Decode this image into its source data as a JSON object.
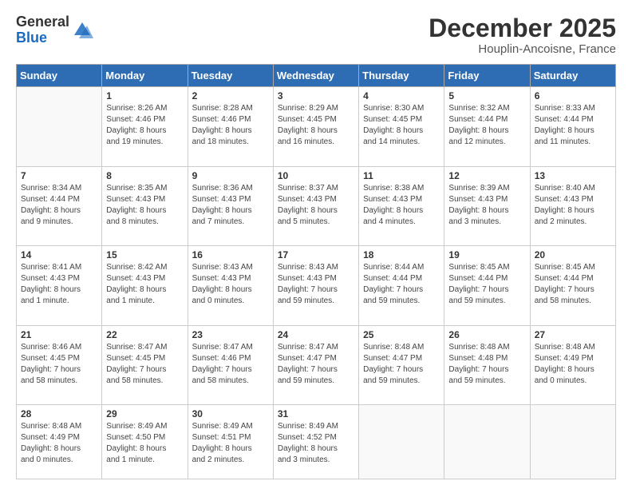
{
  "logo": {
    "general": "General",
    "blue": "Blue"
  },
  "header": {
    "month": "December 2025",
    "location": "Houplin-Ancoisne, France"
  },
  "weekdays": [
    "Sunday",
    "Monday",
    "Tuesday",
    "Wednesday",
    "Thursday",
    "Friday",
    "Saturday"
  ],
  "weeks": [
    [
      {
        "day": "",
        "info": ""
      },
      {
        "day": "1",
        "info": "Sunrise: 8:26 AM\nSunset: 4:46 PM\nDaylight: 8 hours\nand 19 minutes."
      },
      {
        "day": "2",
        "info": "Sunrise: 8:28 AM\nSunset: 4:46 PM\nDaylight: 8 hours\nand 18 minutes."
      },
      {
        "day": "3",
        "info": "Sunrise: 8:29 AM\nSunset: 4:45 PM\nDaylight: 8 hours\nand 16 minutes."
      },
      {
        "day": "4",
        "info": "Sunrise: 8:30 AM\nSunset: 4:45 PM\nDaylight: 8 hours\nand 14 minutes."
      },
      {
        "day": "5",
        "info": "Sunrise: 8:32 AM\nSunset: 4:44 PM\nDaylight: 8 hours\nand 12 minutes."
      },
      {
        "day": "6",
        "info": "Sunrise: 8:33 AM\nSunset: 4:44 PM\nDaylight: 8 hours\nand 11 minutes."
      }
    ],
    [
      {
        "day": "7",
        "info": "Sunrise: 8:34 AM\nSunset: 4:44 PM\nDaylight: 8 hours\nand 9 minutes."
      },
      {
        "day": "8",
        "info": "Sunrise: 8:35 AM\nSunset: 4:43 PM\nDaylight: 8 hours\nand 8 minutes."
      },
      {
        "day": "9",
        "info": "Sunrise: 8:36 AM\nSunset: 4:43 PM\nDaylight: 8 hours\nand 7 minutes."
      },
      {
        "day": "10",
        "info": "Sunrise: 8:37 AM\nSunset: 4:43 PM\nDaylight: 8 hours\nand 5 minutes."
      },
      {
        "day": "11",
        "info": "Sunrise: 8:38 AM\nSunset: 4:43 PM\nDaylight: 8 hours\nand 4 minutes."
      },
      {
        "day": "12",
        "info": "Sunrise: 8:39 AM\nSunset: 4:43 PM\nDaylight: 8 hours\nand 3 minutes."
      },
      {
        "day": "13",
        "info": "Sunrise: 8:40 AM\nSunset: 4:43 PM\nDaylight: 8 hours\nand 2 minutes."
      }
    ],
    [
      {
        "day": "14",
        "info": "Sunrise: 8:41 AM\nSunset: 4:43 PM\nDaylight: 8 hours\nand 1 minute."
      },
      {
        "day": "15",
        "info": "Sunrise: 8:42 AM\nSunset: 4:43 PM\nDaylight: 8 hours\nand 1 minute."
      },
      {
        "day": "16",
        "info": "Sunrise: 8:43 AM\nSunset: 4:43 PM\nDaylight: 8 hours\nand 0 minutes."
      },
      {
        "day": "17",
        "info": "Sunrise: 8:43 AM\nSunset: 4:43 PM\nDaylight: 7 hours\nand 59 minutes."
      },
      {
        "day": "18",
        "info": "Sunrise: 8:44 AM\nSunset: 4:44 PM\nDaylight: 7 hours\nand 59 minutes."
      },
      {
        "day": "19",
        "info": "Sunrise: 8:45 AM\nSunset: 4:44 PM\nDaylight: 7 hours\nand 59 minutes."
      },
      {
        "day": "20",
        "info": "Sunrise: 8:45 AM\nSunset: 4:44 PM\nDaylight: 7 hours\nand 58 minutes."
      }
    ],
    [
      {
        "day": "21",
        "info": "Sunrise: 8:46 AM\nSunset: 4:45 PM\nDaylight: 7 hours\nand 58 minutes."
      },
      {
        "day": "22",
        "info": "Sunrise: 8:47 AM\nSunset: 4:45 PM\nDaylight: 7 hours\nand 58 minutes."
      },
      {
        "day": "23",
        "info": "Sunrise: 8:47 AM\nSunset: 4:46 PM\nDaylight: 7 hours\nand 58 minutes."
      },
      {
        "day": "24",
        "info": "Sunrise: 8:47 AM\nSunset: 4:47 PM\nDaylight: 7 hours\nand 59 minutes."
      },
      {
        "day": "25",
        "info": "Sunrise: 8:48 AM\nSunset: 4:47 PM\nDaylight: 7 hours\nand 59 minutes."
      },
      {
        "day": "26",
        "info": "Sunrise: 8:48 AM\nSunset: 4:48 PM\nDaylight: 7 hours\nand 59 minutes."
      },
      {
        "day": "27",
        "info": "Sunrise: 8:48 AM\nSunset: 4:49 PM\nDaylight: 8 hours\nand 0 minutes."
      }
    ],
    [
      {
        "day": "28",
        "info": "Sunrise: 8:48 AM\nSunset: 4:49 PM\nDaylight: 8 hours\nand 0 minutes."
      },
      {
        "day": "29",
        "info": "Sunrise: 8:49 AM\nSunset: 4:50 PM\nDaylight: 8 hours\nand 1 minute."
      },
      {
        "day": "30",
        "info": "Sunrise: 8:49 AM\nSunset: 4:51 PM\nDaylight: 8 hours\nand 2 minutes."
      },
      {
        "day": "31",
        "info": "Sunrise: 8:49 AM\nSunset: 4:52 PM\nDaylight: 8 hours\nand 3 minutes."
      },
      {
        "day": "",
        "info": ""
      },
      {
        "day": "",
        "info": ""
      },
      {
        "day": "",
        "info": ""
      }
    ]
  ]
}
